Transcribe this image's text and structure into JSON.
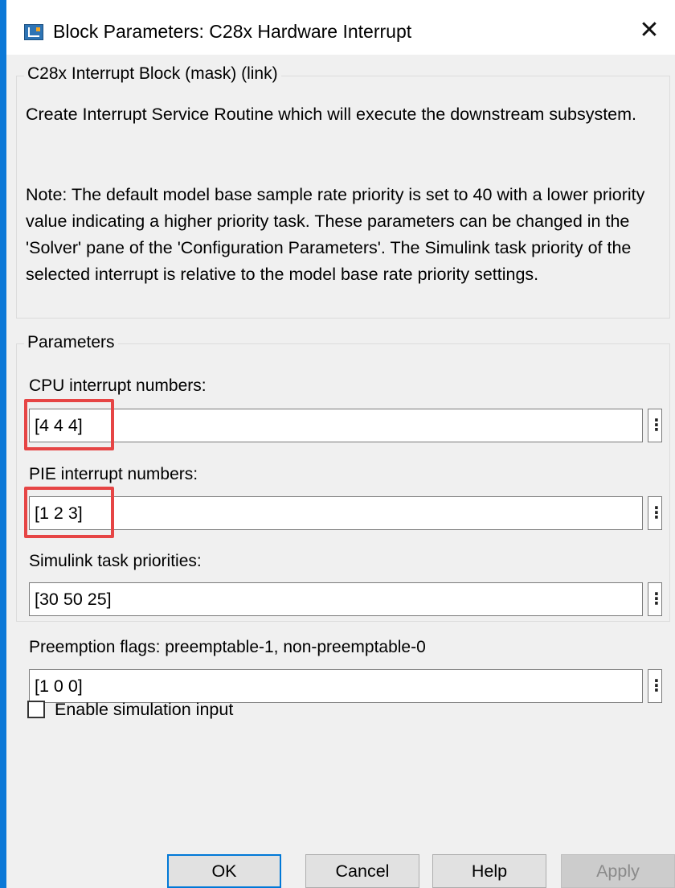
{
  "window": {
    "title": "Block Parameters: C28x Hardware Interrupt",
    "close_glyph": "✕",
    "icon": "simulink-block-icon"
  },
  "mask_group": {
    "legend": "C28x Interrupt Block (mask) (link)",
    "description": "Create Interrupt Service Routine which will execute the downstream subsystem.",
    "note": "Note: The default model base sample rate priority is set to 40 with a lower priority value indicating a higher priority task. These parameters can be changed in the 'Solver' pane of the 'Configuration Parameters'. The Simulink task priority of the selected interrupt is relative to the model base rate priority settings."
  },
  "parameters": {
    "legend": "Parameters",
    "fields": [
      {
        "label": "CPU interrupt numbers:",
        "value": "[4 4 4]",
        "highlighted": true
      },
      {
        "label": "PIE interrupt numbers:",
        "value": "[1 2 3]",
        "highlighted": true
      },
      {
        "label": "Simulink task priorities:",
        "value": "[30 50 25]",
        "highlighted": false
      },
      {
        "label": "Preemption flags: preemptable-1, non-preemptable-0",
        "value": "[1 0 0]",
        "highlighted": false
      }
    ],
    "more_glyph": "⋮",
    "checkbox": {
      "label": "Enable simulation input",
      "checked": false
    }
  },
  "buttons": {
    "ok": "OK",
    "cancel": "Cancel",
    "help": "Help",
    "apply": "Apply"
  },
  "colors": {
    "highlight": "#e64545",
    "desktop": "#0b78d7",
    "default_button_border": "#0078d7"
  }
}
